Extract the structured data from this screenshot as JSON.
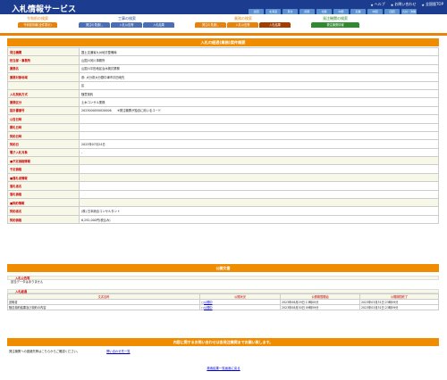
{
  "header": {
    "title": "入札情報サービス",
    "links": [
      {
        "label": "ヘルプ",
        "icon": "help-icon"
      },
      {
        "label": "お問い合わせ",
        "icon": "mail-icon"
      },
      {
        "label": "全国版TOP",
        "icon": "home-icon"
      }
    ],
    "prefs": [
      "全国",
      "北海道",
      "東北",
      "関東",
      "北陸",
      "中部",
      "近畿",
      "中国",
      "四国",
      "九州・沖縄"
    ]
  },
  "nav": {
    "groups": [
      {
        "title": "令和前の検索",
        "tabs": [
          "令和前情報(全件表示)"
        ],
        "color": "#e8820a"
      },
      {
        "title": "工事の検索",
        "tabs": [
          "発注の見通し",
          "入札公告等",
          "入札結果"
        ],
        "color": "#4a6fb8"
      },
      {
        "title": "業務の検索",
        "tabs": [
          "発注の見通し",
          "入札公告等",
          "入札結果"
        ],
        "color": "#e8820a"
      },
      {
        "title": "発注機関の検索",
        "tabs": [
          "発注機関情報"
        ],
        "color": "#2e8b2e"
      }
    ]
  },
  "detail": {
    "title": "入札の経過(業務)案件概要",
    "rows": [
      {
        "label": "発注機関",
        "value": "国土交通省九州地方整備局"
      },
      {
        "label": "担当部・事務所",
        "value": "山国川河川事務所"
      },
      {
        "label": "業務名",
        "value": "山国川平田地区治水検討業務"
      },
      {
        "label": "業務対象地域",
        "value": "県: 大分県大分郡中津市平田地先"
      },
      {
        "label": "",
        "value": "区"
      },
      {
        "label": "入札契約方式",
        "value": "随意契約"
      },
      {
        "label": "業務区分",
        "value": "土木コンサル業務"
      },
      {
        "label": "設計書番号",
        "value": "2023000050020006　　※発注機関が独自に用いるコード"
      },
      {
        "label": "公告日時",
        "value": ""
      },
      {
        "label": "開札日時",
        "value": ""
      },
      {
        "label": "契約日時",
        "value": ""
      },
      {
        "label": "契約日",
        "value": "2023年07月24日"
      },
      {
        "label": "電子入札対象",
        "value": "-"
      },
      {
        "label": "■予定価格情報",
        "value": "",
        "section": true
      },
      {
        "label": "予定価格",
        "value": ""
      },
      {
        "label": "■落札者情報",
        "value": "",
        "section": true
      },
      {
        "label": "落札者名",
        "value": ""
      },
      {
        "label": "落札価格",
        "value": ""
      },
      {
        "label": "■契約情報",
        "value": "",
        "section": true
      },
      {
        "label": "契約者名",
        "value": "(株) 日本総合コンサルタント"
      },
      {
        "label": "契約価格",
        "value": "6,292,000円(税込み)"
      }
    ]
  },
  "docs": {
    "title": "公開文書",
    "bid_result_label": "入札公告等",
    "bid_result_text": "該当データはありません",
    "entry_label": "入札経過",
    "columns": [
      "文書名称",
      "公開状況",
      "公開期間開始",
      "公開期間終了"
    ],
    "rows": [
      {
        "name": "説明書",
        "status": "公開中",
        "start": "2023年08月29日 13時00分",
        "end": "2023年03月31日 23時59分"
      },
      {
        "name": "随意契約結果及び契約の内容",
        "status": "公開中",
        "start": "2023年08月30日 09時59分",
        "end": "2023年03月31日 23時59分"
      }
    ]
  },
  "contact": {
    "title": "内容に関するお問い合わせは各発注機関までお願い致します。",
    "text": "発注機関への連絡先等はこちらからご確認ください。",
    "link": "問い合わせ先一覧"
  },
  "footer": {
    "back": "検索結果一覧画面に戻る"
  }
}
